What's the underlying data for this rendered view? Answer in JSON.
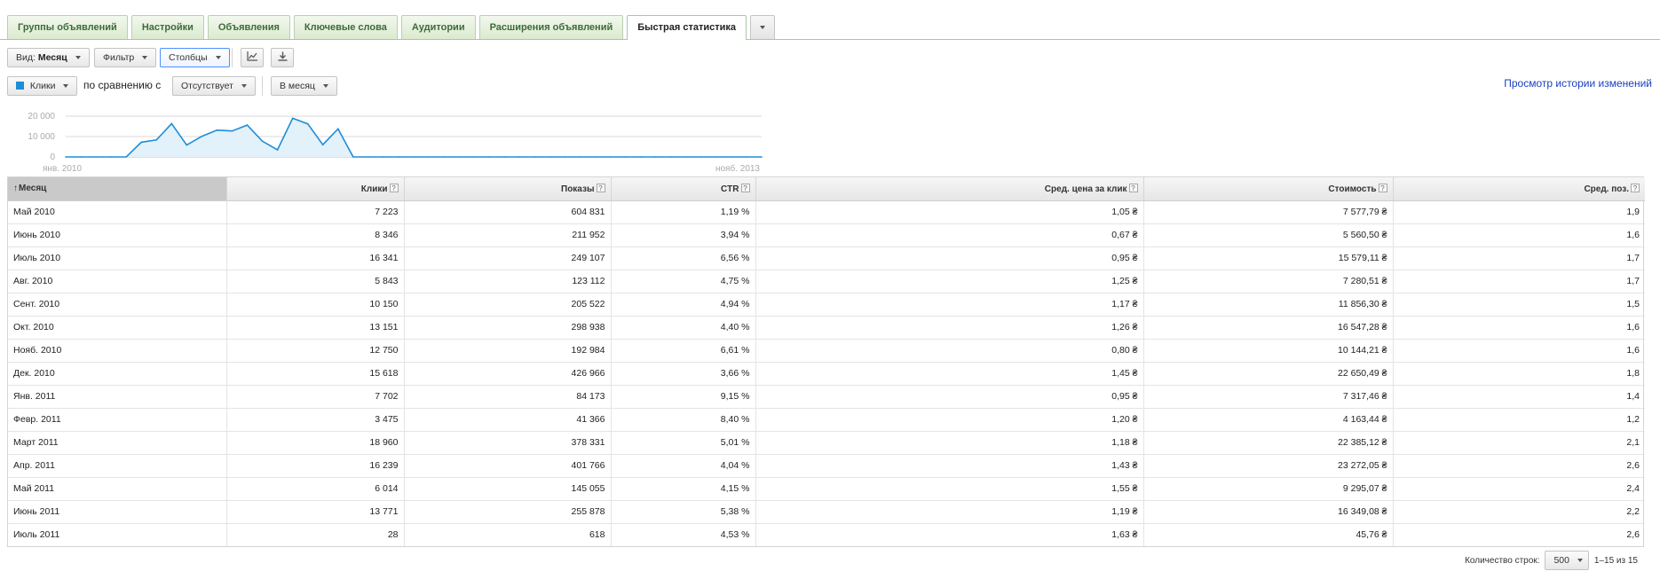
{
  "tabs": [
    {
      "label": "Группы объявлений",
      "active": false
    },
    {
      "label": "Настройки",
      "active": false
    },
    {
      "label": "Объявления",
      "active": false
    },
    {
      "label": "Ключевые слова",
      "active": false
    },
    {
      "label": "Аудитории",
      "active": false
    },
    {
      "label": "Расширения объявлений",
      "active": false
    },
    {
      "label": "Быстрая статистика",
      "active": true
    }
  ],
  "toolbar": {
    "view_prefix": "Вид:",
    "view_value": "Месяц",
    "filter_label": "Фильтр",
    "columns_label": "Столбцы"
  },
  "compare": {
    "metric_label": "Клики",
    "metric_color": "#1f8dd6",
    "compare_text": "по сравнению с",
    "compare_value": "Отсутствует",
    "period_label": "В месяц"
  },
  "history_link": "Просмотр истории изменений",
  "chart_data": {
    "type": "area",
    "series": [
      {
        "name": "Клики",
        "values": [
          0,
          0,
          0,
          0,
          0,
          7223,
          8346,
          16341,
          5843,
          10150,
          13151,
          12750,
          15618,
          7702,
          3475,
          18960,
          16239,
          6014,
          13771,
          28,
          0,
          0,
          0,
          0,
          0,
          0,
          0,
          0,
          0,
          0,
          0,
          0,
          0,
          0,
          0,
          0,
          0,
          0,
          0,
          0,
          0,
          0,
          0,
          0,
          0,
          0,
          0
        ]
      }
    ],
    "yticks": [
      "20 000",
      "10 000",
      "0"
    ],
    "ytick_values": [
      20000,
      10000,
      0
    ],
    "ylim": [
      0,
      20000
    ],
    "x_start_label": "янв. 2010",
    "x_end_label": "нояб. 2013",
    "line_color": "#1f8dd6",
    "fill_color": "#e3f1fa",
    "grid": true
  },
  "table": {
    "columns": [
      {
        "label": "Месяц",
        "help": false,
        "sorted": true
      },
      {
        "label": "Клики",
        "help": true
      },
      {
        "label": "Показы",
        "help": true
      },
      {
        "label": "CTR",
        "help": true
      },
      {
        "label": "Сред. цена за клик",
        "help": true
      },
      {
        "label": "Стоимость",
        "help": true
      },
      {
        "label": "Сред. поз.",
        "help": true
      }
    ],
    "help_glyph": "?",
    "sort_glyph": "↑",
    "rows": [
      [
        "Май 2010",
        "7 223",
        "604 831",
        "1,19 %",
        "1,05 ₴",
        "7 577,79 ₴",
        "1,9"
      ],
      [
        "Июнь 2010",
        "8 346",
        "211 952",
        "3,94 %",
        "0,67 ₴",
        "5 560,50 ₴",
        "1,6"
      ],
      [
        "Июль 2010",
        "16 341",
        "249 107",
        "6,56 %",
        "0,95 ₴",
        "15 579,11 ₴",
        "1,7"
      ],
      [
        "Авг. 2010",
        "5 843",
        "123 112",
        "4,75 %",
        "1,25 ₴",
        "7 280,51 ₴",
        "1,7"
      ],
      [
        "Сент. 2010",
        "10 150",
        "205 522",
        "4,94 %",
        "1,17 ₴",
        "11 856,30 ₴",
        "1,5"
      ],
      [
        "Окт. 2010",
        "13 151",
        "298 938",
        "4,40 %",
        "1,26 ₴",
        "16 547,28 ₴",
        "1,6"
      ],
      [
        "Нояб. 2010",
        "12 750",
        "192 984",
        "6,61 %",
        "0,80 ₴",
        "10 144,21 ₴",
        "1,6"
      ],
      [
        "Дек. 2010",
        "15 618",
        "426 966",
        "3,66 %",
        "1,45 ₴",
        "22 650,49 ₴",
        "1,8"
      ],
      [
        "Янв. 2011",
        "7 702",
        "84 173",
        "9,15 %",
        "0,95 ₴",
        "7 317,46 ₴",
        "1,4"
      ],
      [
        "Февр. 2011",
        "3 475",
        "41 366",
        "8,40 %",
        "1,20 ₴",
        "4 163,44 ₴",
        "1,2"
      ],
      [
        "Март 2011",
        "18 960",
        "378 331",
        "5,01 %",
        "1,18 ₴",
        "22 385,12 ₴",
        "2,1"
      ],
      [
        "Апр. 2011",
        "16 239",
        "401 766",
        "4,04 %",
        "1,43 ₴",
        "23 272,05 ₴",
        "2,6"
      ],
      [
        "Май 2011",
        "6 014",
        "145 055",
        "4,15 %",
        "1,55 ₴",
        "9 295,07 ₴",
        "2,4"
      ],
      [
        "Июнь 2011",
        "13 771",
        "255 878",
        "5,38 %",
        "1,19 ₴",
        "16 349,08 ₴",
        "2,2"
      ],
      [
        "Июль 2011",
        "28",
        "618",
        "4,53 %",
        "1,63 ₴",
        "45,76 ₴",
        "2,6"
      ]
    ]
  },
  "pager": {
    "rows_label": "Количество строк:",
    "rows_value": "500",
    "range_text": "1–15 из 15"
  }
}
